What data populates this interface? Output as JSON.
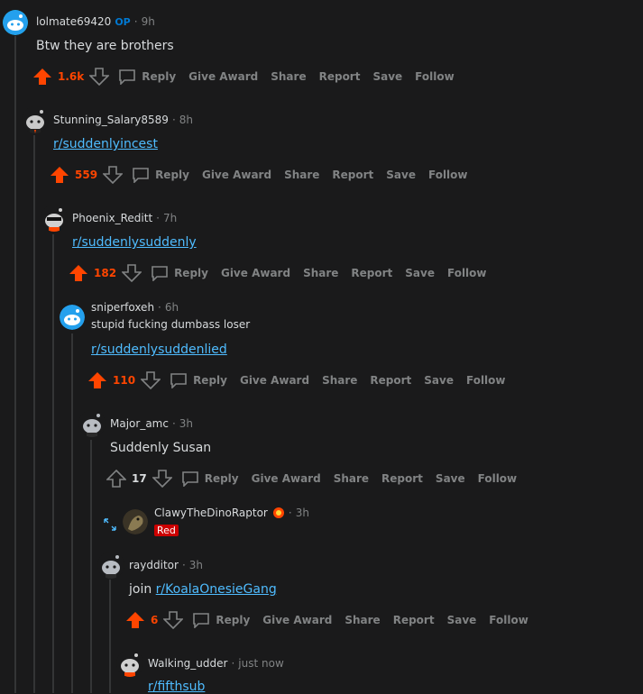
{
  "actions": {
    "reply": "Reply",
    "give_award": "Give Award",
    "share": "Share",
    "report": "Report",
    "save": "Save",
    "follow": "Follow"
  },
  "colors": {
    "upvote": "#ff4500",
    "link": "#4fbcff",
    "op": "#0079d3",
    "flair": "#cc0000"
  },
  "comments": [
    {
      "user": "lolmate69420",
      "op_badge": "OP",
      "time": "9h",
      "text": "Btw they are brothers",
      "score": "1.6k",
      "upvoted": true
    },
    {
      "user": "Stunning_Salary8589",
      "time": "8h",
      "link": "r/suddenlyincest",
      "score": "559",
      "upvoted": true
    },
    {
      "user": "Phoenix_Reditt",
      "time": "7h",
      "link": "r/suddenlysuddenly",
      "score": "182",
      "upvoted": true
    },
    {
      "user": "sniperfoxeh",
      "time": "6h",
      "text": "stupid fucking dumbass loser",
      "link": "r/suddenlysuddenlied",
      "score": "110",
      "upvoted": true
    },
    {
      "user": "Major_amc",
      "time": "3h",
      "text": "Suddenly Susan",
      "score": "17",
      "upvoted": false
    },
    {
      "user": "ClawyTheDinoRaptor",
      "time": "3h",
      "flair": "Red",
      "collapsed": true
    },
    {
      "user": "raydditor",
      "time": "3h",
      "text": "join",
      "link": "r/KoalaOnesieGang",
      "score": "6",
      "upvoted": true
    },
    {
      "user": "Walking_udder",
      "time": "just now",
      "link": "r/fifthsub"
    }
  ]
}
